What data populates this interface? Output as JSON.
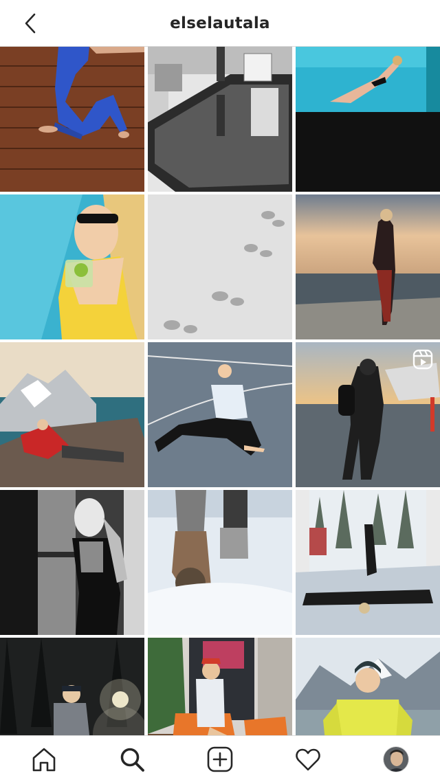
{
  "header": {
    "title": "elselautala",
    "back_icon": "chevron-left-icon"
  },
  "grid": {
    "posts": [
      {
        "subject": "yoga-on-deck",
        "reel": false
      },
      {
        "subject": "pool-reflection",
        "reel": false
      },
      {
        "subject": "underwater-swim",
        "reel": false
      },
      {
        "subject": "poolside-drink",
        "reel": false
      },
      {
        "subject": "snow-footprints",
        "reel": false
      },
      {
        "subject": "sunset-coast",
        "reel": false
      },
      {
        "subject": "mountain-rock",
        "reel": false
      },
      {
        "subject": "court-stretch",
        "reel": false
      },
      {
        "subject": "helipad-walk",
        "reel": true
      },
      {
        "subject": "window-portrait",
        "reel": false
      },
      {
        "subject": "snow-boots",
        "reel": false
      },
      {
        "subject": "bed-snow-window",
        "reel": false
      },
      {
        "subject": "night-forest",
        "reel": false
      },
      {
        "subject": "orange-chairs",
        "reel": false
      },
      {
        "subject": "yellow-jacket",
        "reel": false
      }
    ]
  },
  "tabbar": {
    "items": [
      {
        "icon": "home-icon",
        "active": false
      },
      {
        "icon": "search-icon",
        "active": true
      },
      {
        "icon": "add-post-icon",
        "active": false
      },
      {
        "icon": "heart-icon",
        "active": false
      },
      {
        "icon": "profile-avatar",
        "active": false
      }
    ]
  },
  "colors": {
    "text": "#262626",
    "border": "#dbdbdb",
    "background": "#ffffff"
  }
}
